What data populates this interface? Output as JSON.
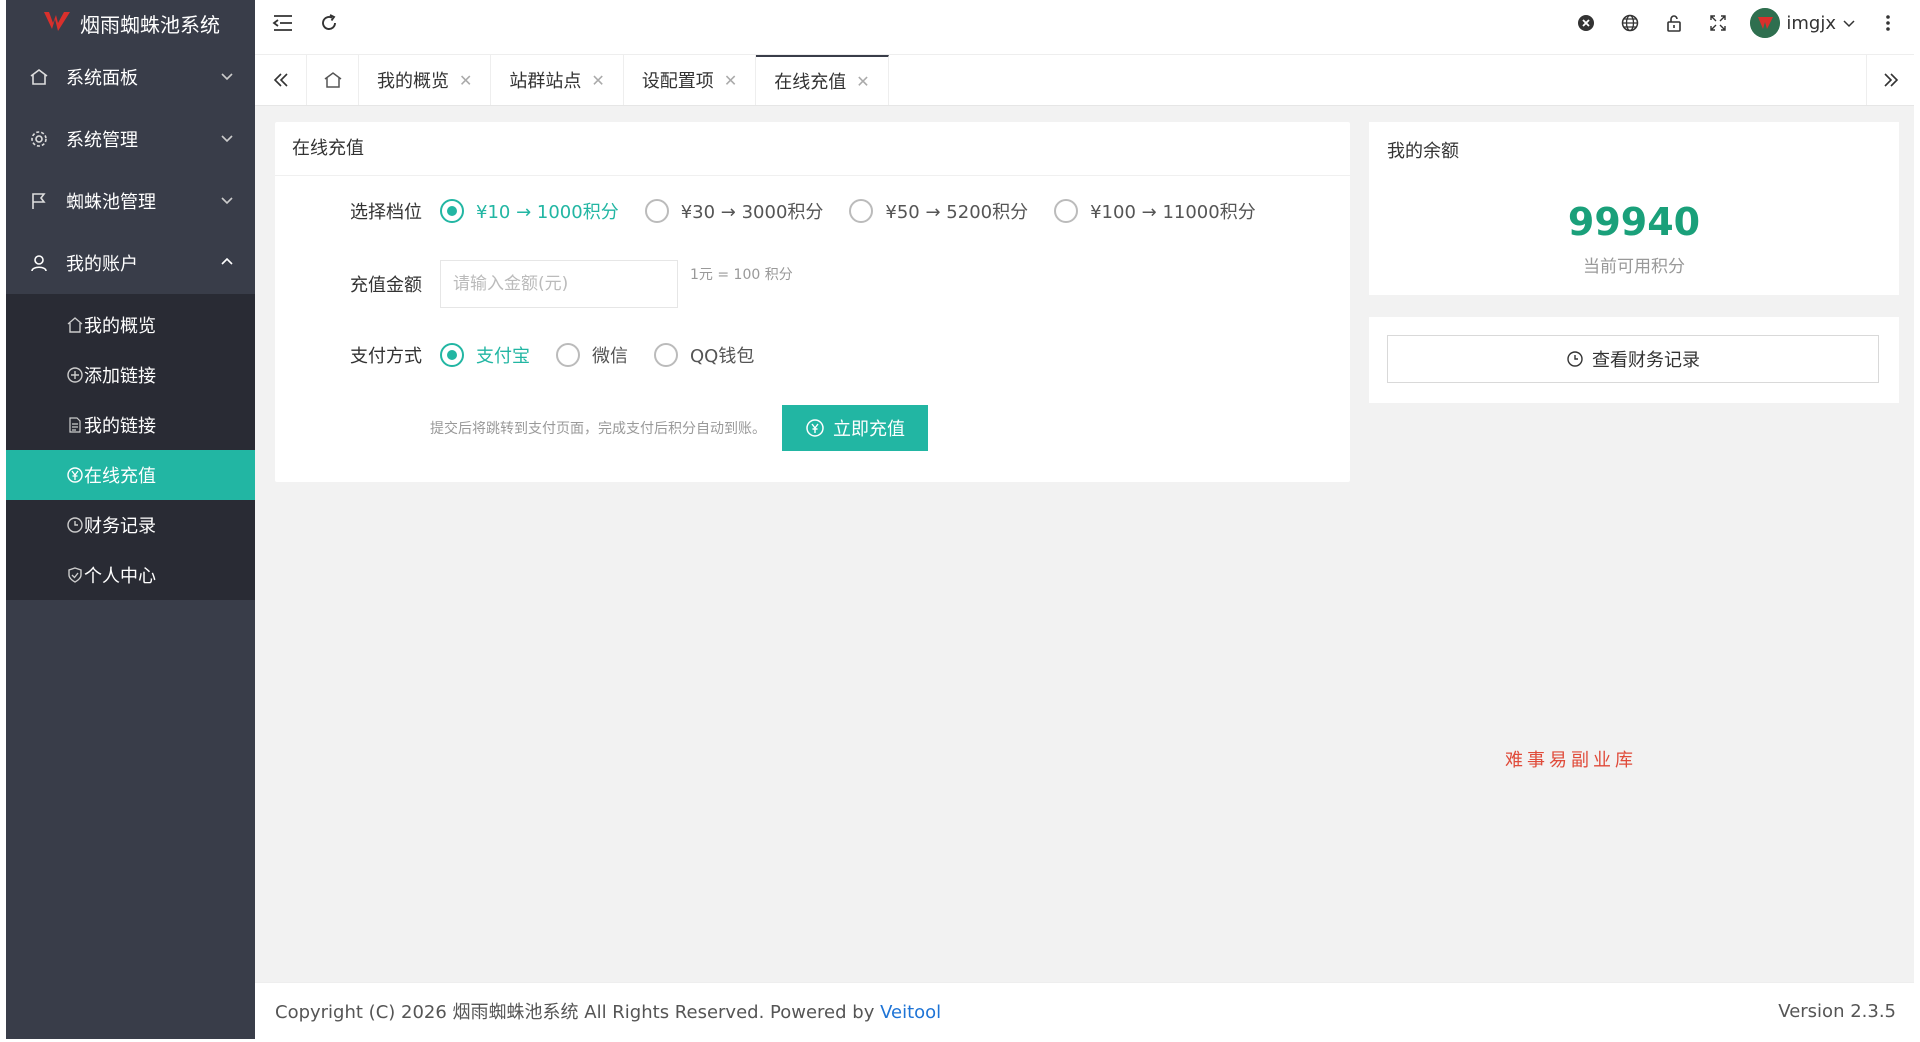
{
  "app": {
    "title": "烟雨蜘蛛池系统"
  },
  "colors": {
    "sidebar": "#393d49",
    "sidebar_child": "#292b34",
    "accent": "#22b6a3",
    "balance": "#1aa07a",
    "link": "#1e74d6",
    "watermark": "#e04b3a"
  },
  "sidebar": {
    "items": [
      {
        "label": "系统面板",
        "icon": "home-icon",
        "expanded": false
      },
      {
        "label": "系统管理",
        "icon": "gear-icon",
        "expanded": false
      },
      {
        "label": "蜘蛛池管理",
        "icon": "flag-icon",
        "expanded": false
      },
      {
        "label": "我的账户",
        "icon": "user-icon",
        "expanded": true
      }
    ],
    "children": [
      {
        "label": "我的概览",
        "icon": "home-icon",
        "active": false
      },
      {
        "label": "添加链接",
        "icon": "add-circle-icon",
        "active": false
      },
      {
        "label": "我的链接",
        "icon": "document-icon",
        "active": false
      },
      {
        "label": "在线充值",
        "icon": "yuan-circle-icon",
        "active": true
      },
      {
        "label": "财务记录",
        "icon": "clock-icon",
        "active": false
      },
      {
        "label": "个人中心",
        "icon": "shield-check-icon",
        "active": false
      }
    ]
  },
  "topbar": {
    "username": "imgjx"
  },
  "tabs": [
    {
      "label": "我的概览",
      "active": false
    },
    {
      "label": "站群站点",
      "active": false
    },
    {
      "label": "设配置项",
      "active": false
    },
    {
      "label": "在线充值",
      "active": true
    }
  ],
  "recharge": {
    "title": "在线充值",
    "tier_label": "选择档位",
    "tiers": [
      {
        "label": "¥10 → 1000积分",
        "checked": true
      },
      {
        "label": "¥30 → 3000积分",
        "checked": false
      },
      {
        "label": "¥50 → 5200积分",
        "checked": false
      },
      {
        "label": "¥100 → 11000积分",
        "checked": false
      }
    ],
    "amount_label": "充值金额",
    "amount_placeholder": "请输入金额(元)",
    "amount_value": "",
    "rate_hint": "1元 = 100 积分",
    "pay_label": "支付方式",
    "pay_methods": [
      {
        "label": "支付宝",
        "checked": true
      },
      {
        "label": "微信",
        "checked": false
      },
      {
        "label": "QQ钱包",
        "checked": false
      }
    ],
    "submit_note": "提交后将跳转到支付页面，完成支付后积分自动到账。",
    "submit_label": "立即充值"
  },
  "balance": {
    "title": "我的余额",
    "value": "99940",
    "label": "当前可用积分"
  },
  "records": {
    "button_label": "查看财务记录"
  },
  "watermark": "难事易副业库",
  "footer": {
    "copyright": "Copyright (C) 2026 烟雨蜘蛛池系统 All Rights Reserved. Powered by ",
    "powered_link": "Veitool",
    "version": "Version 2.3.5"
  }
}
